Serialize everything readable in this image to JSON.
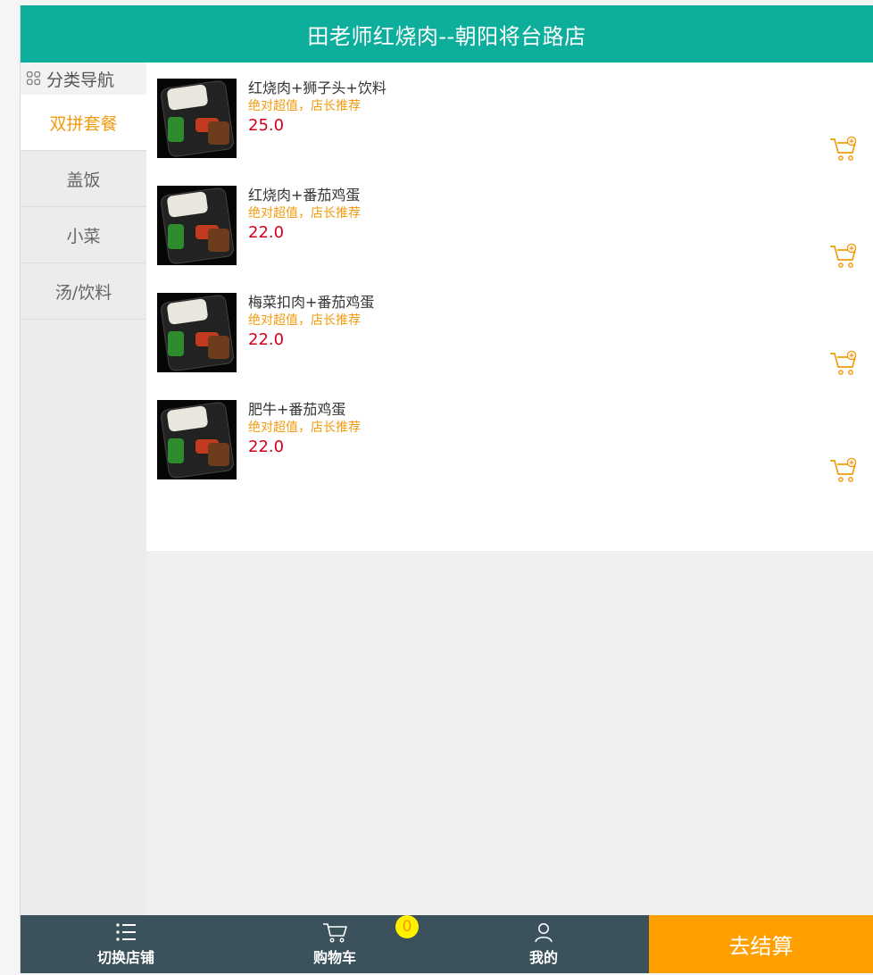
{
  "header": {
    "title": "田老师红烧肉--朝阳将台路店"
  },
  "sidebar": {
    "title": "分类导航",
    "categories": [
      {
        "label": "双拼套餐",
        "active": true
      },
      {
        "label": "盖饭"
      },
      {
        "label": "小菜"
      },
      {
        "label": "汤/饮料"
      }
    ]
  },
  "products": [
    {
      "name": "红烧肉+狮子头+饮料",
      "slogan": "绝对超值，店长推荐",
      "price": "25.0"
    },
    {
      "name": "红烧肉+番茄鸡蛋",
      "slogan": "绝对超值，店长推荐",
      "price": "22.0"
    },
    {
      "name": "梅菜扣肉+番茄鸡蛋",
      "slogan": "绝对超值，店长推荐",
      "price": "22.0"
    },
    {
      "name": "肥牛+番茄鸡蛋",
      "slogan": "绝对超值，店长推荐",
      "price": "22.0"
    }
  ],
  "bottom_nav": {
    "tabs": [
      {
        "label": "切换店铺",
        "icon": "list-icon"
      },
      {
        "label": "购物车",
        "icon": "cart-icon"
      },
      {
        "label": "我的",
        "icon": "user-icon"
      }
    ],
    "cart_count": "0",
    "checkout_label": "去结算"
  },
  "colors": {
    "header_bg": "#0eae9c",
    "accent_orange": "#f39a0d",
    "price_red": "#d0021b",
    "bottom_bg": "#3b525d",
    "checkout_bg": "#ff9f00"
  }
}
